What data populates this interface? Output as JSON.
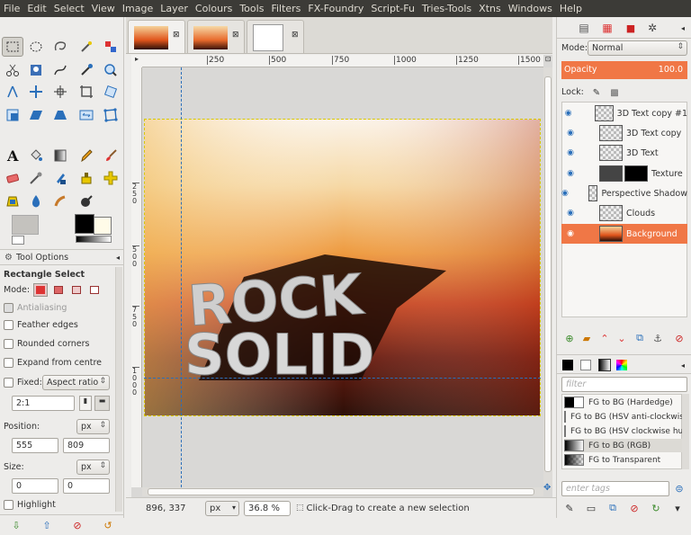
{
  "menu": [
    "File",
    "Edit",
    "Select",
    "View",
    "Image",
    "Layer",
    "Colours",
    "Tools",
    "Filters",
    "FX-Foundry",
    "Script-Fu",
    "Tries-Tools",
    "Xtns",
    "Windows",
    "Help"
  ],
  "tool_options": {
    "tab_label": "Tool Options",
    "tool_name": "Rectangle Select",
    "mode_label": "Mode:",
    "antialiasing": "Antialiasing",
    "feather": "Feather edges",
    "rounded": "Rounded corners",
    "expand": "Expand from centre",
    "fixed": "Fixed:",
    "fixed_value": "Aspect ratio",
    "ratio": "2:1",
    "position_label": "Position:",
    "position_unit": "px",
    "pos_x": "555",
    "pos_y": "809",
    "size_label": "Size:",
    "size_unit": "px",
    "size_w": "0",
    "size_h": "0",
    "highlight": "Highlight"
  },
  "ruler_h": [
    "250",
    "500",
    "750",
    "1000",
    "1250",
    "1500"
  ],
  "ruler_v": [
    "250",
    "500",
    "750",
    "1000"
  ],
  "canvas_text": {
    "line1": "ROCK",
    "line2": "SOLID"
  },
  "status": {
    "coords": "896, 337",
    "unit": "px",
    "zoom": "36.8 %",
    "message": "Click-Drag to create a new selection"
  },
  "layers_panel": {
    "mode_label": "Mode:",
    "mode_value": "Normal",
    "opacity_label": "Opacity",
    "opacity_value": "100.0",
    "lock_label": "Lock:",
    "layers": [
      "3D Text copy #1",
      "3D Text copy",
      "3D Text",
      "Texture",
      "Perspective Shadow",
      "Clouds",
      "Background"
    ]
  },
  "gradients_panel": {
    "filter_placeholder": "filter",
    "tags_placeholder": "enter tags",
    "items": [
      "FG to BG (Hardedge)",
      "FG to BG (HSV anti-clockwise)",
      "FG to BG (HSV clockwise hue)",
      "FG to BG (RGB)",
      "FG to Transparent"
    ]
  },
  "colors": {
    "accent": "#f07746",
    "menubar": "#3c3b37"
  }
}
